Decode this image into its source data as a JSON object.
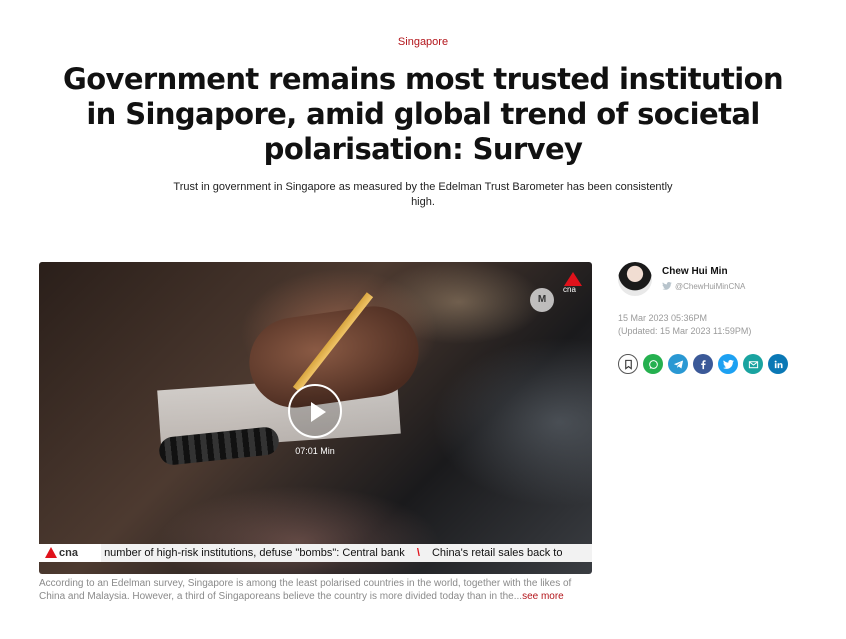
{
  "article": {
    "category": "Singapore",
    "headline": "Government remains most trusted institution in Singapore, amid global trend of societal polarisation: Survey",
    "dek": "Trust in government in Singapore as measured by the Edelman Trust Barometer has been consistently high."
  },
  "video": {
    "duration": "07:01 Min",
    "corner_logo": "cna",
    "ticker_logo": "cna",
    "ticker_items": [
      "number of high-risk institutions, defuse \"bombs\": Central bank",
      "China's retail sales back to"
    ],
    "caption": "According to an Edelman survey, Singapore is among the least polarised countries in the world, together with the likes of China and Malaysia. However, a third of Singaporeans believe the country is more divided today than in the...",
    "see_more_label": "see more"
  },
  "author": {
    "name": "Chew Hui Min",
    "handle": "@ChewHuiMinCNA",
    "published": "15 Mar 2023 05:36PM",
    "updated": "(Updated: 15 Mar 2023 11:59PM)"
  },
  "share": {
    "icons": [
      "bookmark-icon",
      "whatsapp-icon",
      "telegram-icon",
      "facebook-icon",
      "twitter-icon",
      "email-icon",
      "linkedin-icon"
    ]
  },
  "colors": {
    "brand_red": "#b3151b",
    "cna_red": "#e0121b",
    "whatsapp": "#25b04f",
    "telegram": "#2a98d3",
    "facebook": "#3b5998",
    "twitter": "#1da1f2",
    "email": "#19a3a0",
    "linkedin": "#0a78b5"
  }
}
